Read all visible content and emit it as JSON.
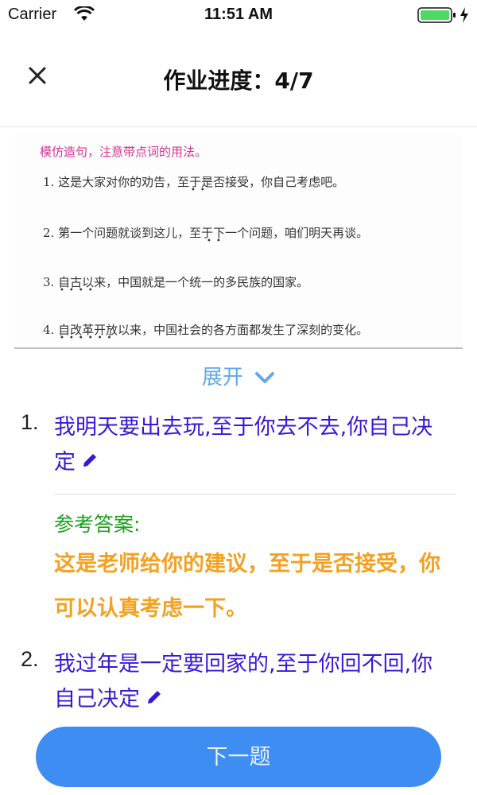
{
  "status_bar": {
    "carrier": "Carrier",
    "time": "11:51 AM",
    "battery_color": "#4cd964"
  },
  "nav": {
    "close_icon": "close-icon",
    "title": "作业进度：4/7"
  },
  "task_image": {
    "instruction": "模仿造句，注意带点词的用法。",
    "lines": [
      "1. 这是大家对你的劝告，至于是否接受，你自己考虑吧。",
      "2. 第一个问题就谈到这儿，至于下一个问题，咱们明天再谈。",
      "3. 自古以来，中国就是一个统一的多民族的国家。",
      "4. 自改革开放以来，中国社会的各方面都发生了深刻的变化。"
    ]
  },
  "expand": {
    "label": "展开",
    "icon": "chevron-down-icon",
    "color": "#62a8e8"
  },
  "questions": [
    {
      "number": "1.",
      "answer": "我明天要出去玩,至于你去不去,你自己决定",
      "reference_label": "参考答案:",
      "reference": "这是老师给你的建议，至于是否接受，你可以认真考虑一下。"
    },
    {
      "number": "2.",
      "answer": "我过年是一定要回家的,至于你回不回,你自己决定"
    }
  ],
  "colors": {
    "answer_text": "#3a17d6",
    "reference_label": "#1aa31a",
    "reference_text": "#f5a020",
    "button_bg": "#3d8df2"
  },
  "next_button": {
    "label": "下一题"
  }
}
